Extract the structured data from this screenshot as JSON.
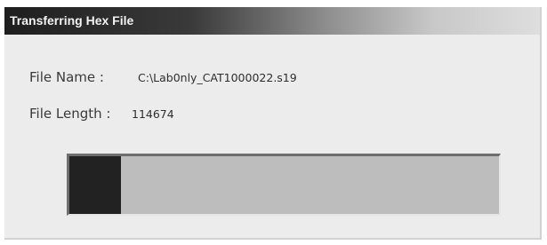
{
  "window": {
    "title": "Transferring Hex File"
  },
  "fields": {
    "file_name_label": "File Name :",
    "file_name_value": "C:\\Lab0nly_CAT1000022.s19",
    "file_length_label": "File Length :",
    "file_length_value": "114674"
  },
  "progress": {
    "fraction": 0.12
  },
  "colors": {
    "window_bg": "#ececec",
    "progress_track": "#bdbdbd",
    "progress_fill": "#222222"
  }
}
